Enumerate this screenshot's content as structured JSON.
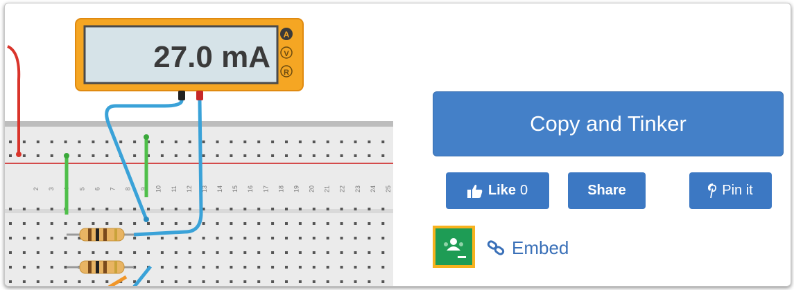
{
  "multimeter": {
    "reading": "27.0 mA",
    "modes": [
      "A",
      "V",
      "R"
    ],
    "active_mode": "A"
  },
  "breadboard": {
    "column_numbers": [
      "2",
      "3",
      "4",
      "5",
      "6",
      "7",
      "8",
      "9",
      "10",
      "11",
      "12",
      "13",
      "14",
      "15",
      "16",
      "17",
      "18",
      "19",
      "20",
      "21",
      "22",
      "23",
      "24",
      "25"
    ]
  },
  "actions": {
    "copy_label": "Copy and Tinker",
    "like_label": "Like",
    "like_count": "0",
    "share_label": "Share",
    "pin_label": "Pin it",
    "embed_label": "Embed"
  },
  "colors": {
    "multimeter_body": "#f5a623",
    "display_bg": "#d6e3e8",
    "wire_blue": "#3aa2d8",
    "wire_green": "#4fbf4a",
    "wire_red": "#d9342b",
    "button_blue": "#4480c8",
    "classroom_green": "#1e9c55",
    "classroom_border": "#f7b21e"
  }
}
